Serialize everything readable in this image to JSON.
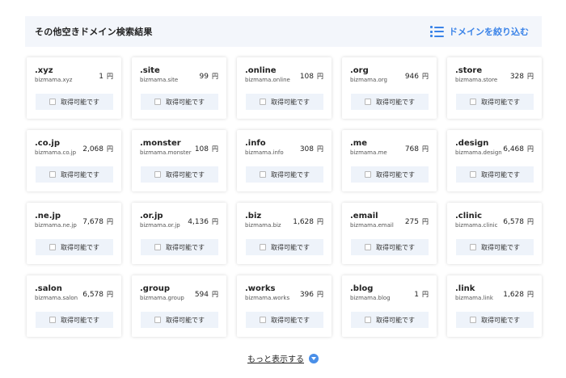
{
  "header": {
    "title": "その他空きドメイン検索結果",
    "filter_label": "ドメインを絞り込む"
  },
  "colors": {
    "accent": "#3a83e8",
    "header_bg": "#f3f6fb",
    "button_bg": "#eef3fa"
  },
  "currency": "円",
  "availability_label": "取得可能です",
  "domains": [
    {
      "tld": ".xyz",
      "name": "bizmama.xyz",
      "price": "1"
    },
    {
      "tld": ".site",
      "name": "bizmama.site",
      "price": "99"
    },
    {
      "tld": ".online",
      "name": "bizmama.online",
      "price": "108"
    },
    {
      "tld": ".org",
      "name": "bizmama.org",
      "price": "946"
    },
    {
      "tld": ".store",
      "name": "bizmama.store",
      "price": "328"
    },
    {
      "tld": ".co.jp",
      "name": "bizmama.co.jp",
      "price": "2,068"
    },
    {
      "tld": ".monster",
      "name": "bizmama.monster",
      "price": "108"
    },
    {
      "tld": ".info",
      "name": "bizmama.info",
      "price": "308"
    },
    {
      "tld": ".me",
      "name": "bizmama.me",
      "price": "768"
    },
    {
      "tld": ".design",
      "name": "bizmama.design",
      "price": "6,468"
    },
    {
      "tld": ".ne.jp",
      "name": "bizmama.ne.jp",
      "price": "7,678"
    },
    {
      "tld": ".or.jp",
      "name": "bizmama.or.jp",
      "price": "4,136"
    },
    {
      "tld": ".biz",
      "name": "bizmama.biz",
      "price": "1,628"
    },
    {
      "tld": ".email",
      "name": "bizmama.email",
      "price": "275"
    },
    {
      "tld": ".clinic",
      "name": "bizmama.clinic",
      "price": "6,578"
    },
    {
      "tld": ".salon",
      "name": "bizmama.salon",
      "price": "6,578"
    },
    {
      "tld": ".group",
      "name": "bizmama.group",
      "price": "594"
    },
    {
      "tld": ".works",
      "name": "bizmama.works",
      "price": "396"
    },
    {
      "tld": ".blog",
      "name": "bizmama.blog",
      "price": "1"
    },
    {
      "tld": ".link",
      "name": "bizmama.link",
      "price": "1,628"
    }
  ],
  "more_label": "もっと表示する",
  "icons": {
    "filter": "list-icon",
    "more": "chevron-down-circle-icon",
    "checkbox": "checkbox-icon"
  }
}
